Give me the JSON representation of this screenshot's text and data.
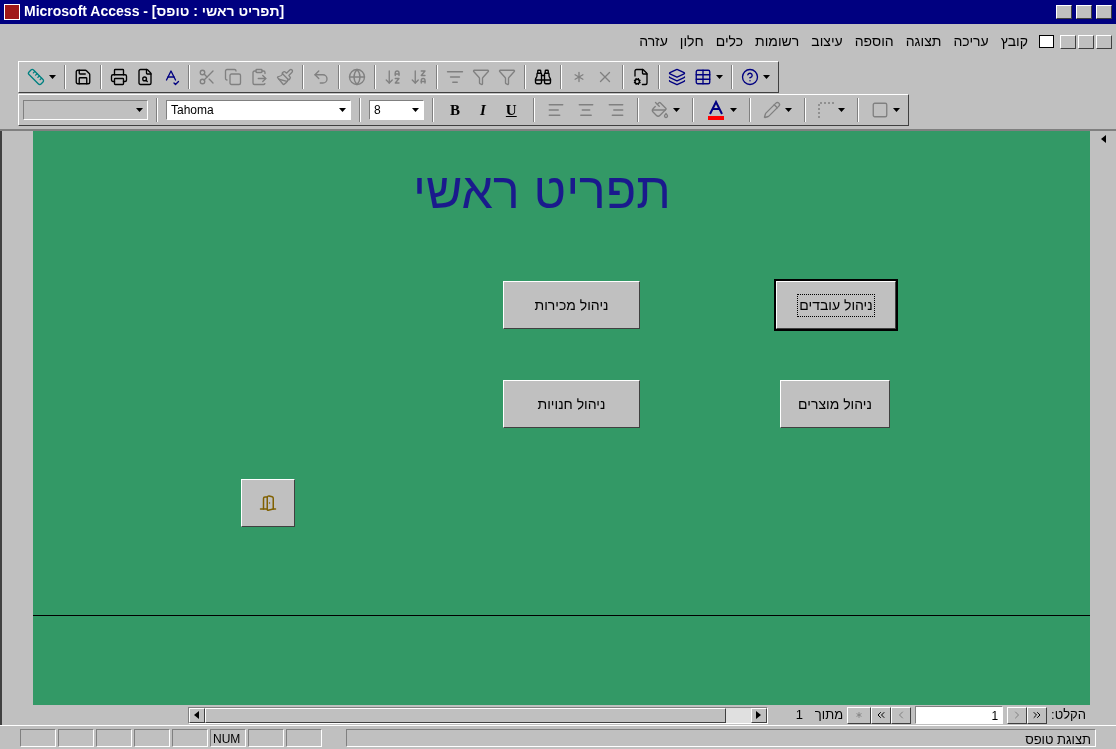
{
  "window": {
    "title": "Microsoft Access - [תפריט ראשי : טופס]"
  },
  "menu": [
    {
      "label": "קובץ"
    },
    {
      "label": "עריכה"
    },
    {
      "label": "תצוגה"
    },
    {
      "label": "הוספה"
    },
    {
      "label": "עיצוב"
    },
    {
      "label": "רשומות"
    },
    {
      "label": "כלים"
    },
    {
      "label": "חלון"
    },
    {
      "label": "עזרה"
    }
  ],
  "format_bar": {
    "font": "Tahoma",
    "size": "8",
    "bold": "B",
    "italic": "I",
    "underline": "U"
  },
  "form": {
    "title": "תפריט ראשי",
    "buttons": [
      {
        "label": "ניהול עובדים",
        "focused": true
      },
      {
        "label": "ניהול מכירות",
        "focused": false
      },
      {
        "label": "ניהול מוצרים",
        "focused": false
      },
      {
        "label": "ניהול חנויות",
        "focused": false
      }
    ]
  },
  "record_nav": {
    "label": "הקלט:",
    "current": "1",
    "of_label": "מתוך",
    "total": "1"
  },
  "status_bar": {
    "text": "תצוגת טופס",
    "indicator": "NUM"
  }
}
